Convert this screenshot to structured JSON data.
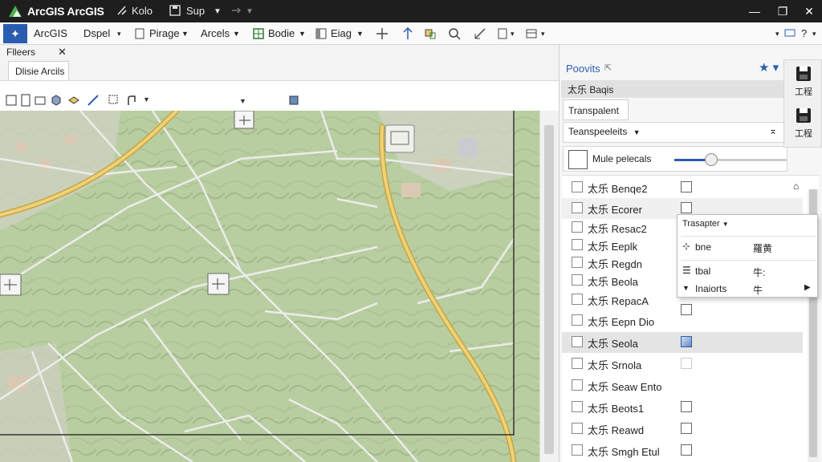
{
  "titlebar": {
    "app_title": "ArcGIS ArcGIS",
    "item1": "Kolo",
    "item2": "Sup",
    "minimize": "—",
    "maximize": "❐",
    "close": "✕"
  },
  "ribbon": {
    "tabs": [
      "ArcGIS",
      "Dspel",
      "Pirage",
      "Arcels",
      "Bodie",
      "Eiag"
    ]
  },
  "map_panel": {
    "header_label": "Flleers",
    "header_close": "✕",
    "active_tab": "Dlisie Arcils",
    "controls": "⌐ | ✕"
  },
  "right_panel": {
    "title": "Poovits",
    "subheader": "太乐 Baqis",
    "transparent_tab": "Transpalent",
    "dropdown": "Teanspeeleits",
    "slider_label": "Mule pelecals",
    "slider_value": 0.33,
    "side_buttons": [
      "工程",
      "工程"
    ]
  },
  "layers": [
    {
      "label": "太乐 Benqe2",
      "checked": false
    },
    {
      "label": "太乐 Ecorer",
      "checked": false
    },
    {
      "label": "太乐 Resac2",
      "checked": false
    },
    {
      "label": "太乐 Eeplk",
      "checked": false
    },
    {
      "label": "太乐 Regdn",
      "checked": false
    },
    {
      "label": "太乐 Beola",
      "checked": false
    },
    {
      "label": "太乐 RepacA",
      "checked": false
    },
    {
      "label": "太乐 Eepn Dio",
      "checked": false
    },
    {
      "label": "太乐 Seola",
      "checked": true
    },
    {
      "label": "太乐 Srnola",
      "checked": false
    },
    {
      "label": "太乐 Seaw Ento",
      "checked": false
    },
    {
      "label": "太乐 Beots1",
      "checked": false
    },
    {
      "label": "太乐 Reawd",
      "checked": false
    },
    {
      "label": "太乐 Smgh Etul",
      "checked": false
    }
  ],
  "context_menu": {
    "header": "Trasapter",
    "items": [
      {
        "label": "bne",
        "key": "羅黄"
      },
      {
        "label": "tbal",
        "key": "牛:"
      },
      {
        "label": "Inaiorts",
        "key": "牛"
      }
    ]
  },
  "colors": {
    "accent": "#2a5db0",
    "titlebar": "#1e1e1e",
    "map_base": "#b7cc9e",
    "road_major": "#e7c86a"
  }
}
